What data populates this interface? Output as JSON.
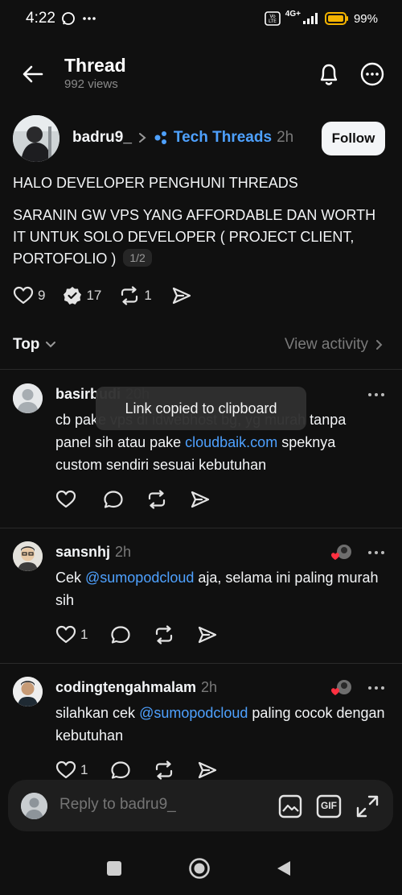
{
  "status_bar": {
    "time": "4:22",
    "network": "4G+",
    "battery": "99%"
  },
  "header": {
    "title": "Thread",
    "views": "992 views"
  },
  "post": {
    "username": "badru9_",
    "community": "Tech Threads",
    "time": "2h",
    "follow_label": "Follow",
    "text_1": "HALO DEVELOPER PENGHUNI THREADS",
    "text_2": "SARANIN GW VPS YANG AFFORDABLE DAN WORTH IT UNTUK SOLO DEVELOPER ( PROJECT CLIENT, PORTOFOLIO )",
    "page_badge": "1/2",
    "likes": "9",
    "replies": "17",
    "reposts": "1"
  },
  "sort": {
    "label": "Top",
    "view_activity": "View activity"
  },
  "toast": "Link copied to clipboard",
  "replies": [
    {
      "username": "basirbudi",
      "time": "20h",
      "text_parts": [
        "cb pake vps di idwebhost bg, yg murah tanpa panel sih atau pake ",
        "cloudbaik.com",
        " speknya custom sendiri sesuai kebutuhan"
      ],
      "likes": ""
    },
    {
      "username": "sansnhj",
      "time": "2h",
      "text_parts": [
        "Cek ",
        "@sumopodcloud",
        "  aja, selama ini paling murah sih"
      ],
      "likes": "1"
    },
    {
      "username": "codingtengahmalam",
      "time": "2h",
      "text_parts": [
        "silahkan cek ",
        "@sumopodcloud",
        " paling cocok dengan kebutuhan"
      ],
      "likes": "1"
    }
  ],
  "reply_bar": {
    "placeholder": "Reply to badru9_",
    "gif_label": "GIF"
  },
  "colors": {
    "background": "#101010",
    "link": "#4ea1ff",
    "text": "#f3f5f7",
    "muted": "#7a7a7a"
  },
  "icons": [
    "back-arrow-icon",
    "bell-icon",
    "more-icon",
    "heart-icon",
    "reply-icon",
    "repost-icon",
    "send-icon",
    "chevron-down-icon",
    "chevron-right-icon",
    "image-icon",
    "gif-icon",
    "expand-icon",
    "home-square-icon",
    "home-circle-icon",
    "back-triangle-icon"
  ]
}
